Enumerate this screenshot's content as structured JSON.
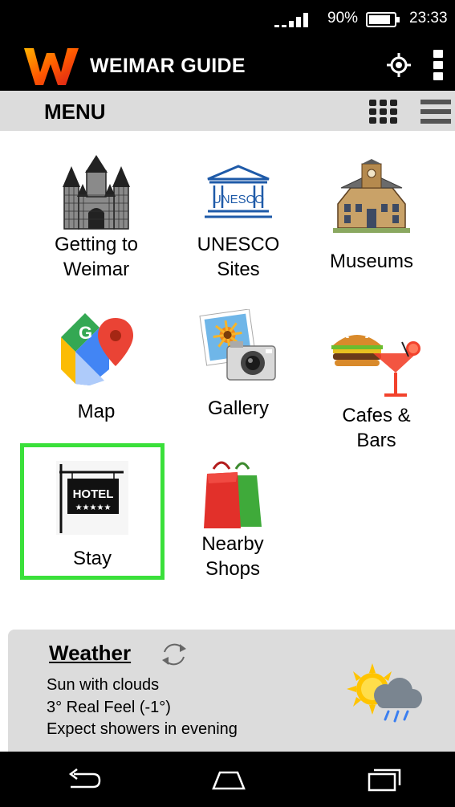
{
  "status_bar": {
    "battery": "90%",
    "time": "23:33"
  },
  "app_bar": {
    "title": "WEIMAR GUIDE",
    "icons": [
      "weimar-logo",
      "locate-icon",
      "more-vert-icon"
    ]
  },
  "menu_bar": {
    "title": "MENU",
    "icons": [
      "grid-view-icon",
      "list-view-icon"
    ]
  },
  "tiles": [
    {
      "label_1": "Getting to",
      "label_2": "Weimar",
      "icon": "castle-icon"
    },
    {
      "label_1": "UNESCO",
      "label_2": "Sites",
      "icon": "unesco-icon",
      "icon_text": "UNESCO"
    },
    {
      "label_1": "Museums",
      "icon": "museum-building-icon"
    },
    {
      "label_1": "Map",
      "icon": "google-maps-icon",
      "icon_text": "G"
    },
    {
      "label_1": "Gallery",
      "icon": "gallery-camera-icon"
    },
    {
      "label_1": "Cafes &",
      "label_2": "Bars",
      "icon": "burger-cocktail-icon"
    },
    {
      "label_1": "Stay",
      "icon": "hotel-sign-icon",
      "icon_text_1": "HOTEL",
      "icon_text_2": "★★★★★",
      "selected": true
    },
    {
      "label_1": "Nearby",
      "label_2": "Shops",
      "icon": "shopping-bags-icon"
    }
  ],
  "weather": {
    "title": "Weather",
    "line1": "Sun with clouds",
    "line2": "3° Real Feel (-1°)",
    "line3": "Expect showers in evening",
    "icons": [
      "refresh-icon",
      "sun-cloud-rain-icon"
    ]
  },
  "nav_bar": {
    "icons": [
      "back-icon",
      "home-icon",
      "recents-icon"
    ]
  },
  "colors": {
    "highlight": "#3ae03a",
    "bar_background": "#000000",
    "menu_background": "#dcdcdc"
  }
}
